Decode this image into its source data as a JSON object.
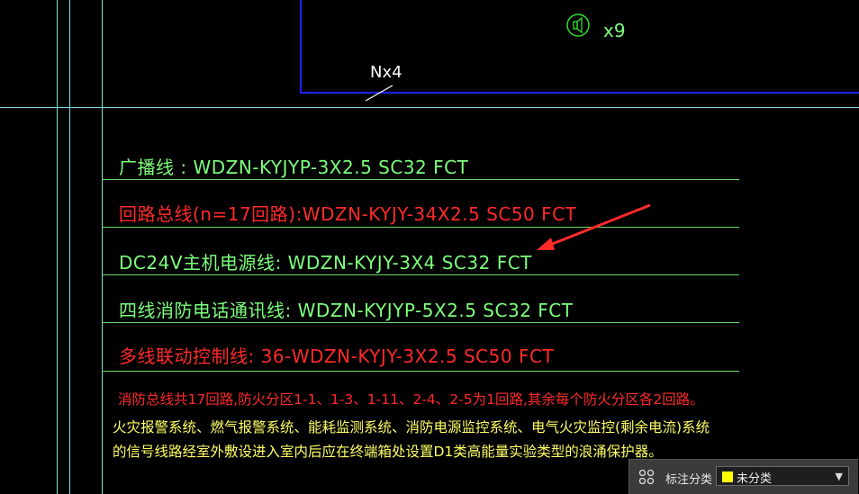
{
  "drawing": {
    "speaker_count": "x9",
    "n_count": "Nx4",
    "legend_rows": [
      {
        "text": "广播线 : WDZN-KYJYP-3X2.5  SC32  FCT",
        "color": "#7dff7d"
      },
      {
        "text": "回路总线(n=17回路):WDZN-KYJY-34X2.5  SC50  FCT",
        "color": "#ff2a2a"
      },
      {
        "text": "DC24V主机电源线: WDZN-KYJY-3X4  SC32  FCT",
        "color": "#7dff7d"
      },
      {
        "text": "四线消防电话通讯线: WDZN-KYJYP-5X2.5  SC32  FCT",
        "color": "#7dff7d"
      },
      {
        "text": "多线联动控制线: 36-WDZN-KYJY-3X2.5  SC50  FCT",
        "color": "#ff2a2a"
      }
    ],
    "note_red": "消防总线共17回路,防火分区1-1、1-3、1-11、2-4、2-5为1回路,其余每个防火分区各2回路。",
    "note_green_1": "火灾报警系统、燃气报警系统、能耗监测系统、消防电源监控系统、电气火灾监控(剩余电流)系统",
    "note_green_2": "的信号线路经室外敷设进入室内后应在终端箱处设置D1类高能量实验类型的浪涌保护器。",
    "colors": {
      "arrow": "#ff2a2a",
      "frame": "#6bd86b",
      "outline": "#2020ff"
    }
  },
  "panel": {
    "label": "标注分类",
    "selected": "未分类",
    "icon": "grid-icon"
  }
}
